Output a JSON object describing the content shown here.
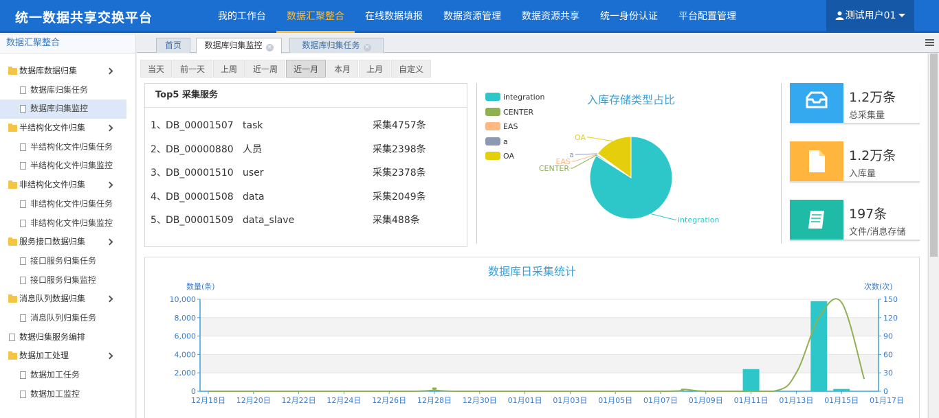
{
  "app": {
    "title": "统一数据共享交换平台"
  },
  "nav": {
    "items": [
      {
        "label": "我的工作台",
        "active": false
      },
      {
        "label": "数据汇聚整合",
        "active": true
      },
      {
        "label": "在线数据填报",
        "active": false
      },
      {
        "label": "数据资源管理",
        "active": false
      },
      {
        "label": "数据资源共享",
        "active": false
      },
      {
        "label": "统一身份认证",
        "active": false
      },
      {
        "label": "平台配置管理",
        "active": false
      }
    ]
  },
  "user": {
    "name": "测试用户01",
    "icon": "user-icon"
  },
  "sidebar": {
    "title": "数据汇聚整合",
    "items": [
      {
        "type": "group",
        "label": "数据库数据归集",
        "expandable": true
      },
      {
        "type": "sub",
        "label": "数据库归集任务"
      },
      {
        "type": "sub",
        "label": "数据库归集监控",
        "active": true
      },
      {
        "type": "group",
        "label": "半结构化文件归集",
        "expandable": true
      },
      {
        "type": "sub",
        "label": "半结构化文件归集任务"
      },
      {
        "type": "sub",
        "label": "半结构化文件归集监控"
      },
      {
        "type": "group",
        "label": "非结构化文件归集",
        "expandable": true
      },
      {
        "type": "sub",
        "label": "非结构化文件归集任务"
      },
      {
        "type": "sub",
        "label": "非结构化文件归集监控"
      },
      {
        "type": "group",
        "label": "服务接口数据归集",
        "expandable": true
      },
      {
        "type": "sub",
        "label": "接口服务归集任务"
      },
      {
        "type": "sub",
        "label": "接口服务归集监控"
      },
      {
        "type": "group",
        "label": "消息队列数据归集",
        "expandable": true
      },
      {
        "type": "sub",
        "label": "消息队列归集任务"
      },
      {
        "type": "doc",
        "label": "数据归集服务编排"
      },
      {
        "type": "group",
        "label": "数据加工处理",
        "expandable": true
      },
      {
        "type": "sub",
        "label": "数据加工任务"
      },
      {
        "type": "sub",
        "label": "数据加工监控"
      }
    ]
  },
  "tabs": [
    {
      "label": "首页",
      "closable": false,
      "active": false
    },
    {
      "label": "数据库归集监控",
      "closable": true,
      "active": true
    },
    {
      "label": "数据库归集任务",
      "closable": true,
      "active": false
    }
  ],
  "date_filters": [
    "当天",
    "前一天",
    "上周",
    "近一周",
    "近一月",
    "本月",
    "上月",
    "自定义"
  ],
  "date_filter_active": 4,
  "top5": {
    "title": "Top5 采集服务",
    "rows": [
      {
        "rank": "1、",
        "id": "DB_00001507",
        "name": "task",
        "count": "采集4757条"
      },
      {
        "rank": "2、",
        "id": "DB_00000880",
        "name": "人员",
        "count": "采集2398条"
      },
      {
        "rank": "3、",
        "id": "DB_00001510",
        "name": "user",
        "count": "采集2378条"
      },
      {
        "rank": "4、",
        "id": "DB_00001508",
        "name": "data",
        "count": "采集2049条"
      },
      {
        "rank": "5、",
        "id": "DB_00001509",
        "name": "data_slave",
        "count": "采集488条"
      }
    ]
  },
  "stats": [
    {
      "value": "1.2万条",
      "label": "总采集量",
      "color": "#35a9f0",
      "icon": "inbox-icon"
    },
    {
      "value": "1.2万条",
      "label": "入库量",
      "color": "#ffb53e",
      "icon": "document-icon"
    },
    {
      "value": "197条",
      "label": "文件/消息存储",
      "color": "#1fbba6",
      "icon": "book-icon"
    }
  ],
  "chart_data": [
    {
      "type": "pie",
      "title": "入库存储类型占比",
      "legend_position": "top-left",
      "slices": [
        {
          "name": "integration",
          "value": 84,
          "color": "#2ec7c9"
        },
        {
          "name": "CENTER",
          "value": 0.5,
          "color": "#8fb14f"
        },
        {
          "name": "EAS",
          "value": 0.3,
          "color": "#ffb980"
        },
        {
          "name": "a",
          "value": 0.2,
          "color": "#8d98b3"
        },
        {
          "name": "OA",
          "value": 15,
          "color": "#e5cf0d"
        }
      ]
    },
    {
      "type": "bar",
      "title": "数据库日采集统计",
      "ylabel": "数量(条)",
      "y2label": "次数(次)",
      "ylim": [
        0,
        10000
      ],
      "y2lim": [
        0,
        150
      ],
      "yticks": [
        "0",
        "2,000",
        "4,000",
        "6,000",
        "8,000",
        "10,000"
      ],
      "y2ticks": [
        "0",
        "30",
        "60",
        "90",
        "120",
        "150"
      ],
      "tick_labels": [
        "12月18日",
        "12月20日",
        "12月22日",
        "12月24日",
        "12月26日",
        "12月28日",
        "12月30日",
        "01月01日",
        "01月03日",
        "01月05日",
        "01月07日",
        "01月09日",
        "01月11日",
        "01月13日",
        "01月15日",
        "01月17日"
      ],
      "grid": true,
      "bar_color": "#2ec7c9",
      "line_color": "#8fb14f",
      "series": [
        {
          "kind": "bar",
          "points": [
            [
              24,
              2400
            ],
            [
              27,
              9800
            ],
            [
              28,
              250
            ]
          ]
        },
        {
          "kind": "line",
          "points": [
            [
              0,
              0
            ],
            [
              9,
              0
            ],
            [
              10,
              5
            ],
            [
              11,
              0
            ],
            [
              20,
              0
            ],
            [
              21,
              3
            ],
            [
              22,
              0
            ],
            [
              25,
              0
            ],
            [
              26,
              30
            ],
            [
              27,
              120
            ],
            [
              28,
              145
            ],
            [
              29,
              20
            ]
          ]
        }
      ]
    }
  ]
}
